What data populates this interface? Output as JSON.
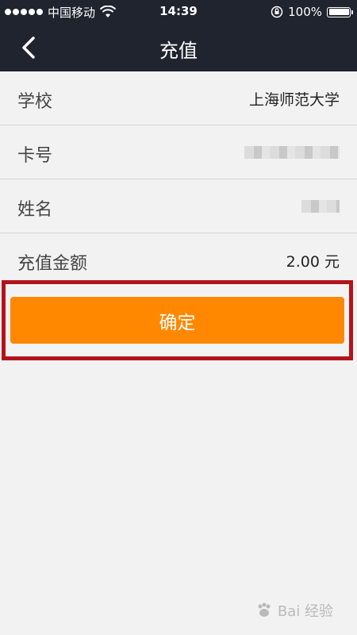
{
  "status_bar": {
    "carrier": "中国移动",
    "time": "14:39",
    "battery": "100%",
    "battery_level": 1.0,
    "wifi_icon": "wifi-icon",
    "lock_icon": "orientation-lock-icon"
  },
  "nav": {
    "title": "充值",
    "back_icon": "chevron-left-icon"
  },
  "form": {
    "rows": [
      {
        "label": "学校",
        "value": "上海师范大学"
      },
      {
        "label": "卡号",
        "value": ""
      },
      {
        "label": "姓名",
        "value": ""
      },
      {
        "label": "充值金额",
        "value": "2.00 元"
      }
    ]
  },
  "confirm_button": {
    "label": "确定"
  },
  "watermark": {
    "text": "Bai 经验"
  },
  "colors": {
    "nav_bg": "#1f242f",
    "accent": "#ff8800",
    "highlight": "#b4121b",
    "page_bg": "#f2f2f2"
  }
}
